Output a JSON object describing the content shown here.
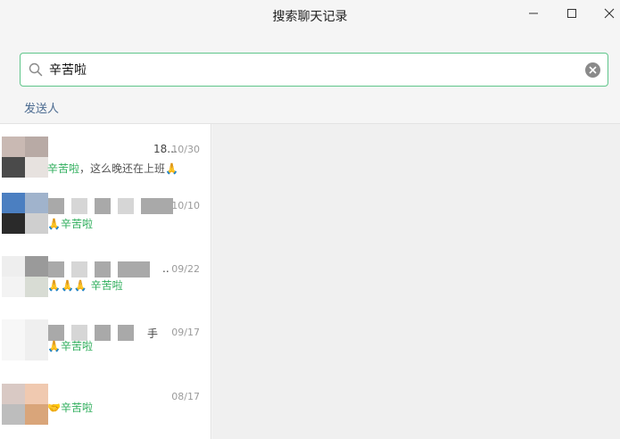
{
  "window": {
    "title": "搜索聊天记录"
  },
  "search": {
    "value": "辛苦啦",
    "placeholder": ""
  },
  "filter": {
    "sender_label": "发送人"
  },
  "results": [
    {
      "name_tail": "18...",
      "date": "10/30",
      "snippet_before": "",
      "keyword": "辛苦啦",
      "snippet_after": "，这么晚还在上班🙏"
    },
    {
      "name_tail": "",
      "date": "10/10",
      "snippet_before": "🙏",
      "keyword": "辛苦啦",
      "snippet_after": ""
    },
    {
      "name_tail": "..",
      "date": "09/22",
      "snippet_before": "🙏🙏🙏 ",
      "keyword": "辛苦啦",
      "snippet_after": ""
    },
    {
      "name_tail": "手",
      "date": "09/17",
      "snippet_before": "🙏",
      "keyword": "辛苦啦",
      "snippet_after": ""
    },
    {
      "name_tail": "",
      "date": "08/17",
      "snippet_before": "🤝",
      "keyword": "辛苦啦",
      "snippet_after": ""
    }
  ]
}
